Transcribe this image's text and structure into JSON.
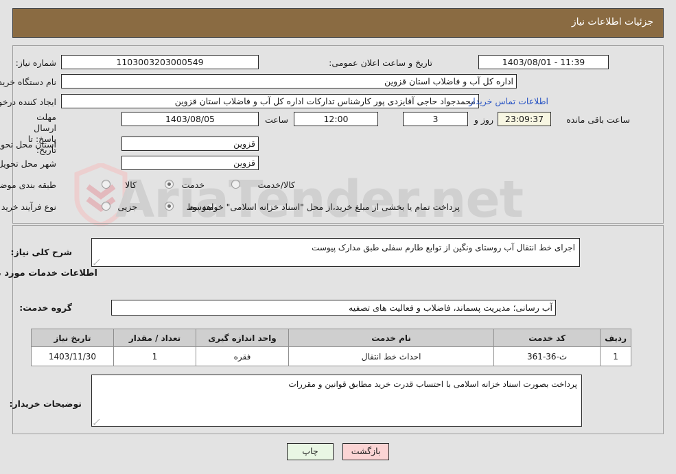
{
  "header": {
    "title": "جزئیات اطلاعات نیاز"
  },
  "watermark": {
    "text": "AriaTender.net",
    "logo": "shield-icon"
  },
  "form": {
    "need_number": {
      "label": "شماره نیاز:",
      "value": "1103003203000549"
    },
    "buyer_org": {
      "label": "نام دستگاه خریدار:",
      "value": "اداره کل آب و فاضلاب استان قزوین"
    },
    "requester": {
      "label": "ایجاد کننده درخواست:",
      "value": "محمدجواد حاجی آقایزدی پور کارشناس تدارکات اداره کل آب و فاضلاب استان قزوین"
    },
    "deadline": {
      "label": "مهلت ارسال پاسخ: تا تاریخ:",
      "value": "1403/08/05"
    },
    "deadline_hour": {
      "label": "ساعت",
      "value": "12:00"
    },
    "delivery_province": {
      "label": "استان محل تحویل:",
      "value": "قزوین"
    },
    "delivery_city": {
      "label": "شهر محل تحویل:",
      "value": "قزوین"
    },
    "announce_datetime": {
      "label": "تاریخ و ساعت اعلان عمومی:",
      "value": "11:39 - 1403/08/01"
    },
    "contact_link": "اطلاعات تماس خریدار",
    "countdown": {
      "days_value": "3",
      "days_label": "روز و",
      "time_value": "23:09:37",
      "remaining_label": "ساعت باقی مانده"
    },
    "category": {
      "label": "طبقه بندی موضوعی:",
      "options": [
        {
          "label": "کالا",
          "selected": false
        },
        {
          "label": "خدمت",
          "selected": true
        },
        {
          "label": "کالا/خدمت",
          "selected": false
        }
      ]
    },
    "process_type": {
      "label": "نوع فرآیند خرید :",
      "options": [
        {
          "label": "جزیی",
          "selected": false
        },
        {
          "label": "متوسط",
          "selected": true
        }
      ],
      "note": "پرداخت تمام یا بخشی از مبلغ خرید،از محل \"اسناد خزانه اسلامی\" خواهد بود."
    }
  },
  "details": {
    "need_description": {
      "label": "شرح کلی نیاز:",
      "value": "اجرای خط انتقال آب روستای ونگین از توابع طارم سفلی طبق مدارک پیوست"
    },
    "services_heading": "اطلاعات خدمات مورد نیاز",
    "service_group": {
      "label": "گروه خدمت:",
      "value": "آب رسانی؛ مدیریت پسماند، فاضلاب و فعالیت های تصفیه"
    },
    "table": {
      "columns": [
        "ردیف",
        "کد خدمت",
        "نام خدمت",
        "واحد اندازه گیری",
        "تعداد / مقدار",
        "تاریخ نیاز"
      ],
      "rows": [
        {
          "index": "1",
          "code": "ث-36-361",
          "name": "احداث خط انتقال",
          "unit": "فقره",
          "quantity": "1",
          "need_date": "1403/11/30"
        }
      ]
    },
    "buyer_notes": {
      "label": "توضیحات خریدار:",
      "value": "پرداخت بصورت اسناد خزانه اسلامی با احتساب قدرت خرید مطابق قوانین و مقررات"
    }
  },
  "buttons": {
    "print": "چاپ",
    "back": "بازگشت"
  },
  "colors": {
    "header_bg": "#8a6b42",
    "page_bg": "#e3e3e3",
    "link": "#2b56c4",
    "countdown_bg": "#f7f6e2",
    "table_header_bg": "#cfcfcf",
    "print_btn_bg": "#e9f6e4",
    "back_btn_bg": "#fbd4d4"
  }
}
